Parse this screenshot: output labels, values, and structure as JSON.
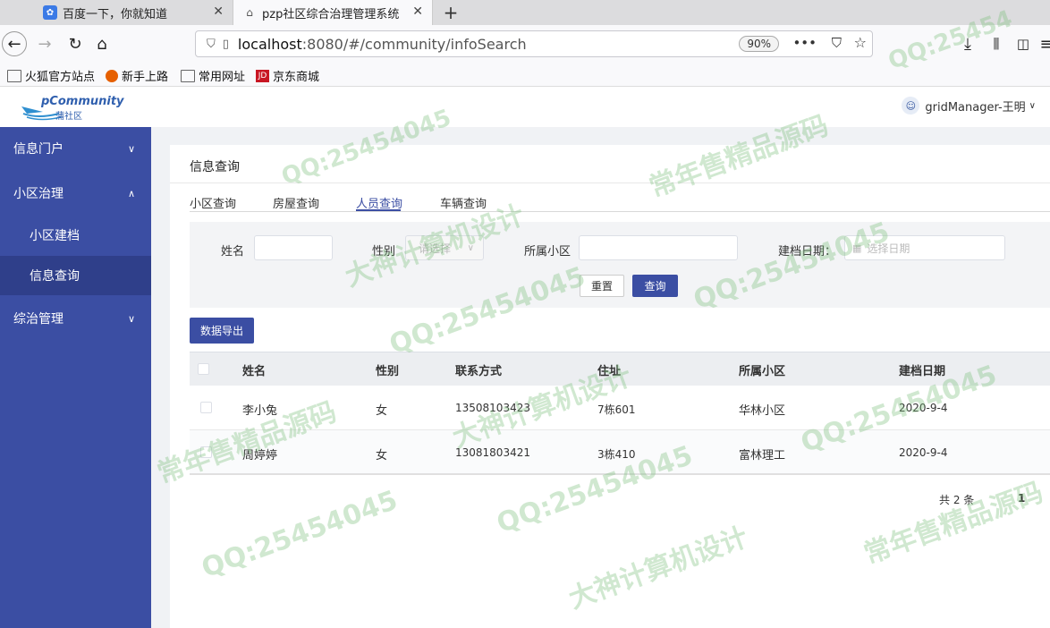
{
  "browser": {
    "tabs": [
      {
        "title": "百度一下，你就知道",
        "icon": "baidu-paw-icon"
      },
      {
        "title": "pzp社区综合治理管理系统",
        "icon": "home-outline-icon"
      }
    ],
    "url_host": "localhost",
    "url_rest": ":8080/#/community/infoSearch",
    "zoom": "90%",
    "bookmarks": [
      "火狐官方站点",
      "新手上路",
      "常用网址",
      "京东商城"
    ]
  },
  "app": {
    "logo_title": "pCommunity",
    "logo_sub": "蒲社区",
    "user": "gridManager-王明",
    "accent": "#3b4ea3"
  },
  "sidebar": {
    "items": [
      {
        "label": "信息门户"
      },
      {
        "label": "小区治理"
      },
      {
        "label": "小区建档"
      },
      {
        "label": "信息查询"
      },
      {
        "label": "综治管理"
      }
    ]
  },
  "card": {
    "title": "信息查询",
    "tabs": [
      "小区查询",
      "房屋查询",
      "人员查询",
      "车辆查询"
    ],
    "active_tab": "人员查询"
  },
  "filter": {
    "name_label": "姓名",
    "gender_label": "性别",
    "gender_placeholder": "请选择",
    "community_label": "所属小区",
    "date_label": "建档日期：",
    "date_placeholder": "选择日期",
    "reset": "重置",
    "query": "查询"
  },
  "export_label": "数据导出",
  "table": {
    "headers": [
      "姓名",
      "性别",
      "联系方式",
      "住址",
      "所属小区",
      "建档日期"
    ],
    "rows": [
      [
        "李小兔",
        "女",
        "13508103423",
        "7栋601",
        "华林小区",
        "2020-9-4"
      ],
      [
        "周婷婷",
        "女",
        "13081803421",
        "3栋410",
        "富林理工",
        "2020-9-4"
      ]
    ]
  },
  "pager": {
    "total": "共 2 条",
    "page": "1"
  },
  "watermark": {
    "qq": "QQ:25454045",
    "line1": "常年售精品源码",
    "line2": "大神计算机设计"
  }
}
